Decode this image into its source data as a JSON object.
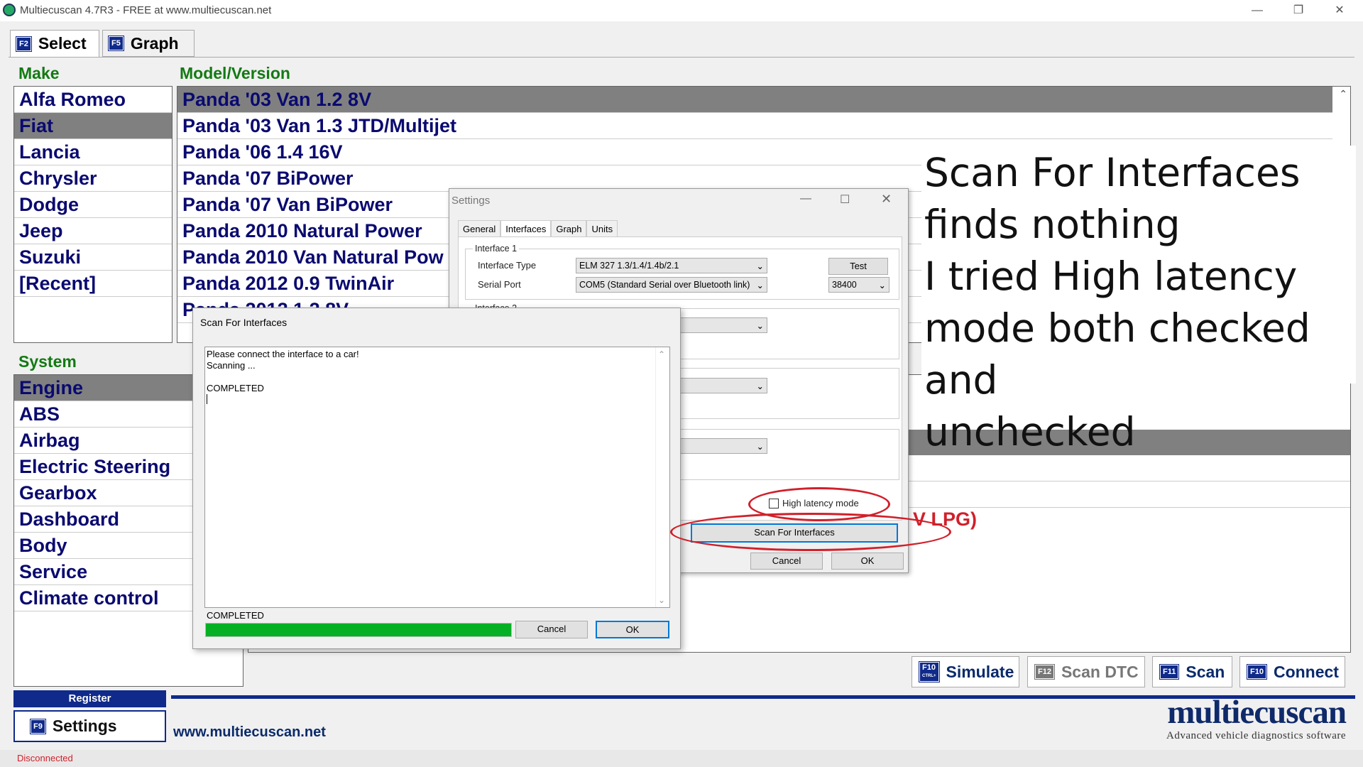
{
  "window": {
    "title": "Multiecuscan 4.7R3 - FREE at www.multiecuscan.net"
  },
  "top_tabs": [
    {
      "key": "F2",
      "label": "Select"
    },
    {
      "key": "F5",
      "label": "Graph"
    }
  ],
  "make": {
    "header": "Make",
    "items": [
      "Alfa Romeo",
      "Fiat",
      "Lancia",
      "Chrysler",
      "Dodge",
      "Jeep",
      "Suzuki",
      "[Recent]"
    ],
    "selected": "Fiat"
  },
  "model": {
    "header": "Model/Version",
    "items": [
      "Panda '03 Van 1.2 8V",
      "Panda '03 Van 1.3 JTD/Multijet",
      "Panda '06 1.4 16V",
      "Panda '07 BiPower",
      "Panda '07 Van BiPower",
      "Panda 2010 Natural Power",
      "Panda 2010 Van Natural Pow",
      "Panda 2012 0.9 TwinAir",
      "Panda 2012 1.2 8V",
      "P"
    ],
    "selected": "Panda '03 Van 1.2 8V",
    "partial_text": "V LPG)"
  },
  "system": {
    "header": "System",
    "items": [
      "Engine",
      "ABS",
      "Airbag",
      "Electric Steering",
      "Gearbox",
      "Dashboard",
      "Body",
      "Service",
      "Climate control"
    ],
    "selected": "Engine"
  },
  "settings_dialog": {
    "title": "Settings",
    "tabs": [
      "General",
      "Interfaces",
      "Graph",
      "Units"
    ],
    "active_tab": "Interfaces",
    "interface1": {
      "group_label": "Interface 1",
      "type_label": "Interface Type",
      "type_value": "ELM 327 1.3/1.4/1.4b/2.1",
      "test_button": "Test",
      "port_label": "Serial Port",
      "port_value": "COM5  (Standard Serial over Bluetooth link)",
      "baud_value": "38400"
    },
    "interface2_label": "Interface 2",
    "high_latency_label": "High latency mode",
    "high_latency_checked": false,
    "scan_button": "Scan For Interfaces",
    "cancel_button": "Cancel",
    "ok_button": "OK"
  },
  "scan_dialog": {
    "title": "Scan For Interfaces",
    "log_lines": [
      "Please connect the interface to a car!",
      "Scanning ...",
      "",
      "COMPLETED"
    ],
    "status": "COMPLETED",
    "progress": 1.0,
    "cancel_button": "Cancel",
    "ok_button": "OK"
  },
  "annotation": {
    "lines": [
      "Scan For Interfaces",
      "finds nothing",
      "I tried High latency",
      "mode both checked and",
      "unchecked"
    ],
    "color": "#d0202a"
  },
  "bottom_buttons": [
    {
      "key": "F10",
      "sub": "CTRL+",
      "label": "Simulate",
      "enabled": true
    },
    {
      "key": "F12",
      "label": "Scan DTC",
      "enabled": false
    },
    {
      "key": "F11",
      "label": "Scan",
      "enabled": true
    },
    {
      "key": "F10",
      "label": "Connect",
      "enabled": true
    }
  ],
  "register_label": "Register",
  "settings_button": {
    "key": "F9",
    "label": "Settings"
  },
  "website": "www.multiecuscan.net",
  "brand": {
    "name": "multiecuscan",
    "tagline": "Advanced vehicle diagnostics software"
  },
  "status_bar": {
    "text": "Disconnected"
  },
  "colors": {
    "accent": "#0f2a8a",
    "header_green": "#137a13",
    "progress_green": "#06b025",
    "status_red": "#d0202a"
  }
}
